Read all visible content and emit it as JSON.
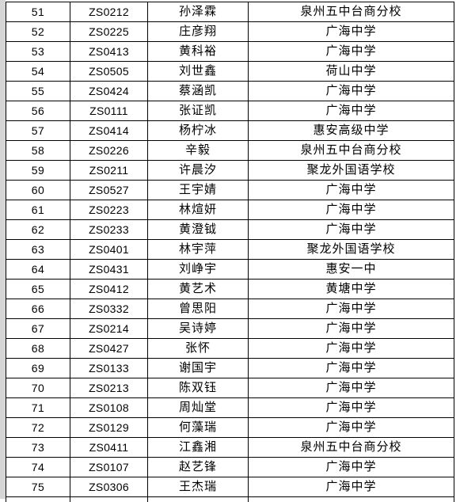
{
  "table": {
    "columns": [
      {
        "key": "index",
        "name": "sequence-number-column"
      },
      {
        "key": "code",
        "name": "candidate-id-column"
      },
      {
        "key": "name",
        "name": "candidate-name-column"
      },
      {
        "key": "school",
        "name": "school-column"
      }
    ],
    "rows": [
      {
        "index": "51",
        "code": "ZS0212",
        "name": "孙泽霖",
        "school": "泉州五中台商分校"
      },
      {
        "index": "52",
        "code": "ZS0225",
        "name": "庄彦翔",
        "school": "广海中学"
      },
      {
        "index": "53",
        "code": "ZS0413",
        "name": "黄科裕",
        "school": "广海中学"
      },
      {
        "index": "54",
        "code": "ZS0505",
        "name": "刘世鑫",
        "school": "荷山中学"
      },
      {
        "index": "55",
        "code": "ZS0424",
        "name": "蔡涵凯",
        "school": "广海中学"
      },
      {
        "index": "56",
        "code": "ZS0111",
        "name": "张证凯",
        "school": "广海中学"
      },
      {
        "index": "57",
        "code": "ZS0414",
        "name": "杨柠冰",
        "school": "惠安高级中学"
      },
      {
        "index": "58",
        "code": "ZS0226",
        "name": "辛毅",
        "school": "泉州五中台商分校"
      },
      {
        "index": "59",
        "code": "ZS0211",
        "name": "许晨汐",
        "school": "聚龙外国语学校"
      },
      {
        "index": "60",
        "code": "ZS0527",
        "name": "王宇婧",
        "school": "广海中学"
      },
      {
        "index": "61",
        "code": "ZS0223",
        "name": "林煊妍",
        "school": "广海中学"
      },
      {
        "index": "62",
        "code": "ZS0233",
        "name": "黄澄钺",
        "school": "广海中学"
      },
      {
        "index": "63",
        "code": "ZS0401",
        "name": "林宇萍",
        "school": "聚龙外国语学校"
      },
      {
        "index": "64",
        "code": "ZS0431",
        "name": "刘峥宇",
        "school": "惠安一中"
      },
      {
        "index": "65",
        "code": "ZS0412",
        "name": "黄艺术",
        "school": "黄塘中学"
      },
      {
        "index": "66",
        "code": "ZS0332",
        "name": "曾思阳",
        "school": "广海中学"
      },
      {
        "index": "67",
        "code": "ZS0214",
        "name": "吴诗婷",
        "school": "广海中学"
      },
      {
        "index": "68",
        "code": "ZS0427",
        "name": "张怀",
        "school": "广海中学"
      },
      {
        "index": "69",
        "code": "ZS0133",
        "name": "谢国宇",
        "school": "广海中学"
      },
      {
        "index": "70",
        "code": "ZS0213",
        "name": "陈双钰",
        "school": "广海中学"
      },
      {
        "index": "71",
        "code": "ZS0108",
        "name": "周灿堂",
        "school": "广海中学"
      },
      {
        "index": "72",
        "code": "ZS0129",
        "name": "何藻瑞",
        "school": "广海中学"
      },
      {
        "index": "73",
        "code": "ZS0411",
        "name": "江鑫湘",
        "school": "泉州五中台商分校"
      },
      {
        "index": "74",
        "code": "ZS0107",
        "name": "赵艺锋",
        "school": "广海中学"
      },
      {
        "index": "75",
        "code": "ZS0306",
        "name": "王杰瑞",
        "school": "广海中学"
      }
    ]
  },
  "colors": {
    "border": "#000000",
    "text": "#000000",
    "background": "#ffffff",
    "gutter": "#d6d6d6"
  }
}
